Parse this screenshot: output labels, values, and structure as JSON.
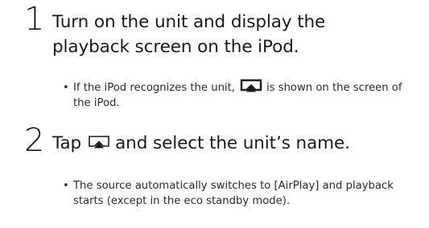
{
  "steps": [
    {
      "number": "1",
      "heading": "Turn on the unit and display the playback screen on the iPod.",
      "bullet_before_icon": "If the iPod recognizes the unit,",
      "bullet_after_icon": "is shown on the screen of the iPod.",
      "icon": "airplay-icon"
    },
    {
      "number": "2",
      "heading_before_icon": "Tap",
      "heading_after_icon": "and select the unit’s name.",
      "bullet": "The source automatically switches to [AirPlay] and playback starts (except in the eco standby mode).",
      "icon": "airplay-icon"
    }
  ],
  "bullet_symbol": "•",
  "colors": {
    "text": "#1a1a1a",
    "background": "#ffffff"
  }
}
